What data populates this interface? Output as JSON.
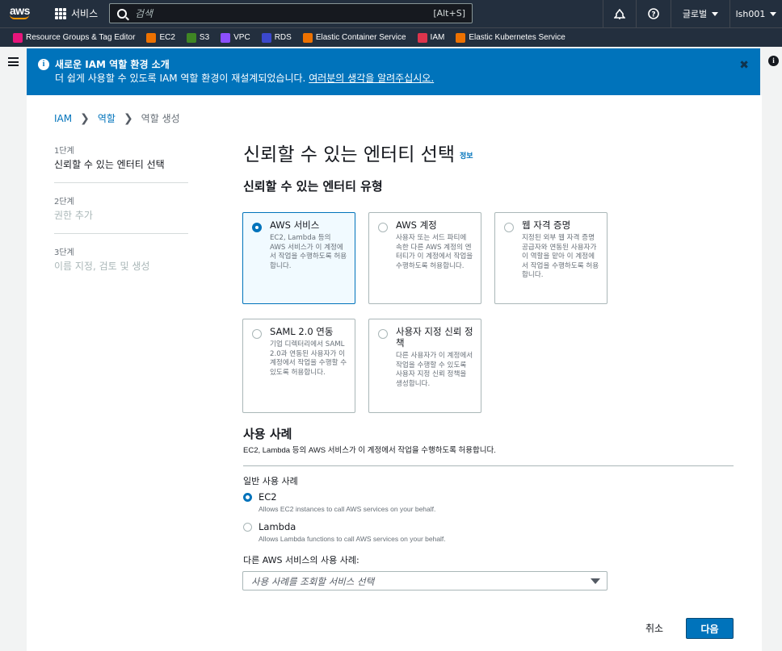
{
  "topnav": {
    "logo": "aws",
    "services_label": "서비스",
    "search_placeholder": "검색",
    "search_hint": "[Alt+S]",
    "region_label": "글로벌",
    "user_label": "lsh001"
  },
  "favorites": [
    {
      "label": "Resource Groups & Tag Editor",
      "color": "#e7157b",
      "icon": "resource-groups-icon"
    },
    {
      "label": "EC2",
      "color": "#ed7100",
      "icon": "ec2-icon"
    },
    {
      "label": "S3",
      "color": "#3f8624",
      "icon": "s3-icon"
    },
    {
      "label": "VPC",
      "color": "#8c4fff",
      "icon": "vpc-icon"
    },
    {
      "label": "RDS",
      "color": "#3b48cc",
      "icon": "rds-icon"
    },
    {
      "label": "Elastic Container Service",
      "color": "#ed7100",
      "icon": "ecs-icon"
    },
    {
      "label": "IAM",
      "color": "#dd344c",
      "icon": "iam-icon"
    },
    {
      "label": "Elastic Kubernetes Service",
      "color": "#ed7100",
      "icon": "eks-icon"
    }
  ],
  "flash": {
    "title": "새로운 IAM 역할 환경 소개",
    "text": "더 쉽게 사용할 수 있도록 IAM 역할 환경이 재설계되었습니다.",
    "link": "여러분의 생각을 알려주십시오.",
    "close": "✖"
  },
  "breadcrumb": {
    "items": [
      "IAM",
      "역할"
    ],
    "current": "역할 생성",
    "separator": "❯"
  },
  "steps": [
    {
      "num": "1단계",
      "label": "신뢰할 수 있는 엔터티 선택",
      "active": true
    },
    {
      "num": "2단계",
      "label": "권한 추가",
      "active": false
    },
    {
      "num": "3단계",
      "label": "이름 지정, 검토 및 생성",
      "active": false
    }
  ],
  "page": {
    "title": "신뢰할 수 있는 엔터티 선택",
    "info_link": "정보",
    "entity_type_heading": "신뢰할 수 있는 엔터티 유형"
  },
  "entity_types": [
    {
      "title": "AWS 서비스",
      "desc": "EC2, Lambda 등의 AWS 서비스가 이 계정에서 작업을 수행하도록 허용합니다.",
      "selected": true
    },
    {
      "title": "AWS 계정",
      "desc": "사용자 또는 서드 파티에 속한 다른 AWS 계정의 엔터티가 이 계정에서 작업을 수행하도록 허용합니다.",
      "selected": false
    },
    {
      "title": "웹 자격 증명",
      "desc": "지정된 외부 웹 자격 증명 공급자와 연동된 사용자가 이 역할을 맡아 이 계정에서 작업을 수행하도록 허용합니다.",
      "selected": false
    },
    {
      "title": "SAML 2.0 연동",
      "desc": "기업 디렉터리에서 SAML 2.0과 연동된 사용자가 이 계정에서 작업을 수행할 수 있도록 허용합니다.",
      "selected": false
    },
    {
      "title": "사용자 지정 신뢰 정책",
      "desc": "다른 사용자가 이 계정에서 작업을 수행할 수 있도록 사용자 지정 신뢰 정책을 생성합니다.",
      "selected": false
    }
  ],
  "use_case": {
    "title": "사용 사례",
    "desc": "EC2, Lambda 등의 AWS 서비스가 이 계정에서 작업을 수행하도록 허용합니다.",
    "common_label": "일반 사용 사례",
    "options": [
      {
        "label": "EC2",
        "desc": "Allows EC2 instances to call AWS services on your behalf.",
        "selected": true
      },
      {
        "label": "Lambda",
        "desc": "Allows Lambda functions to call AWS services on your behalf.",
        "selected": false
      }
    ],
    "other_label": "다른 AWS 서비스의 사용 사례:",
    "select_placeholder": "사용 사례를 조회할 서비스 선택"
  },
  "actions": {
    "cancel": "취소",
    "next": "다음"
  },
  "colors": {
    "nav_bg": "#232f3e",
    "primary": "#0073bb",
    "flash_bg": "#0073bb"
  }
}
